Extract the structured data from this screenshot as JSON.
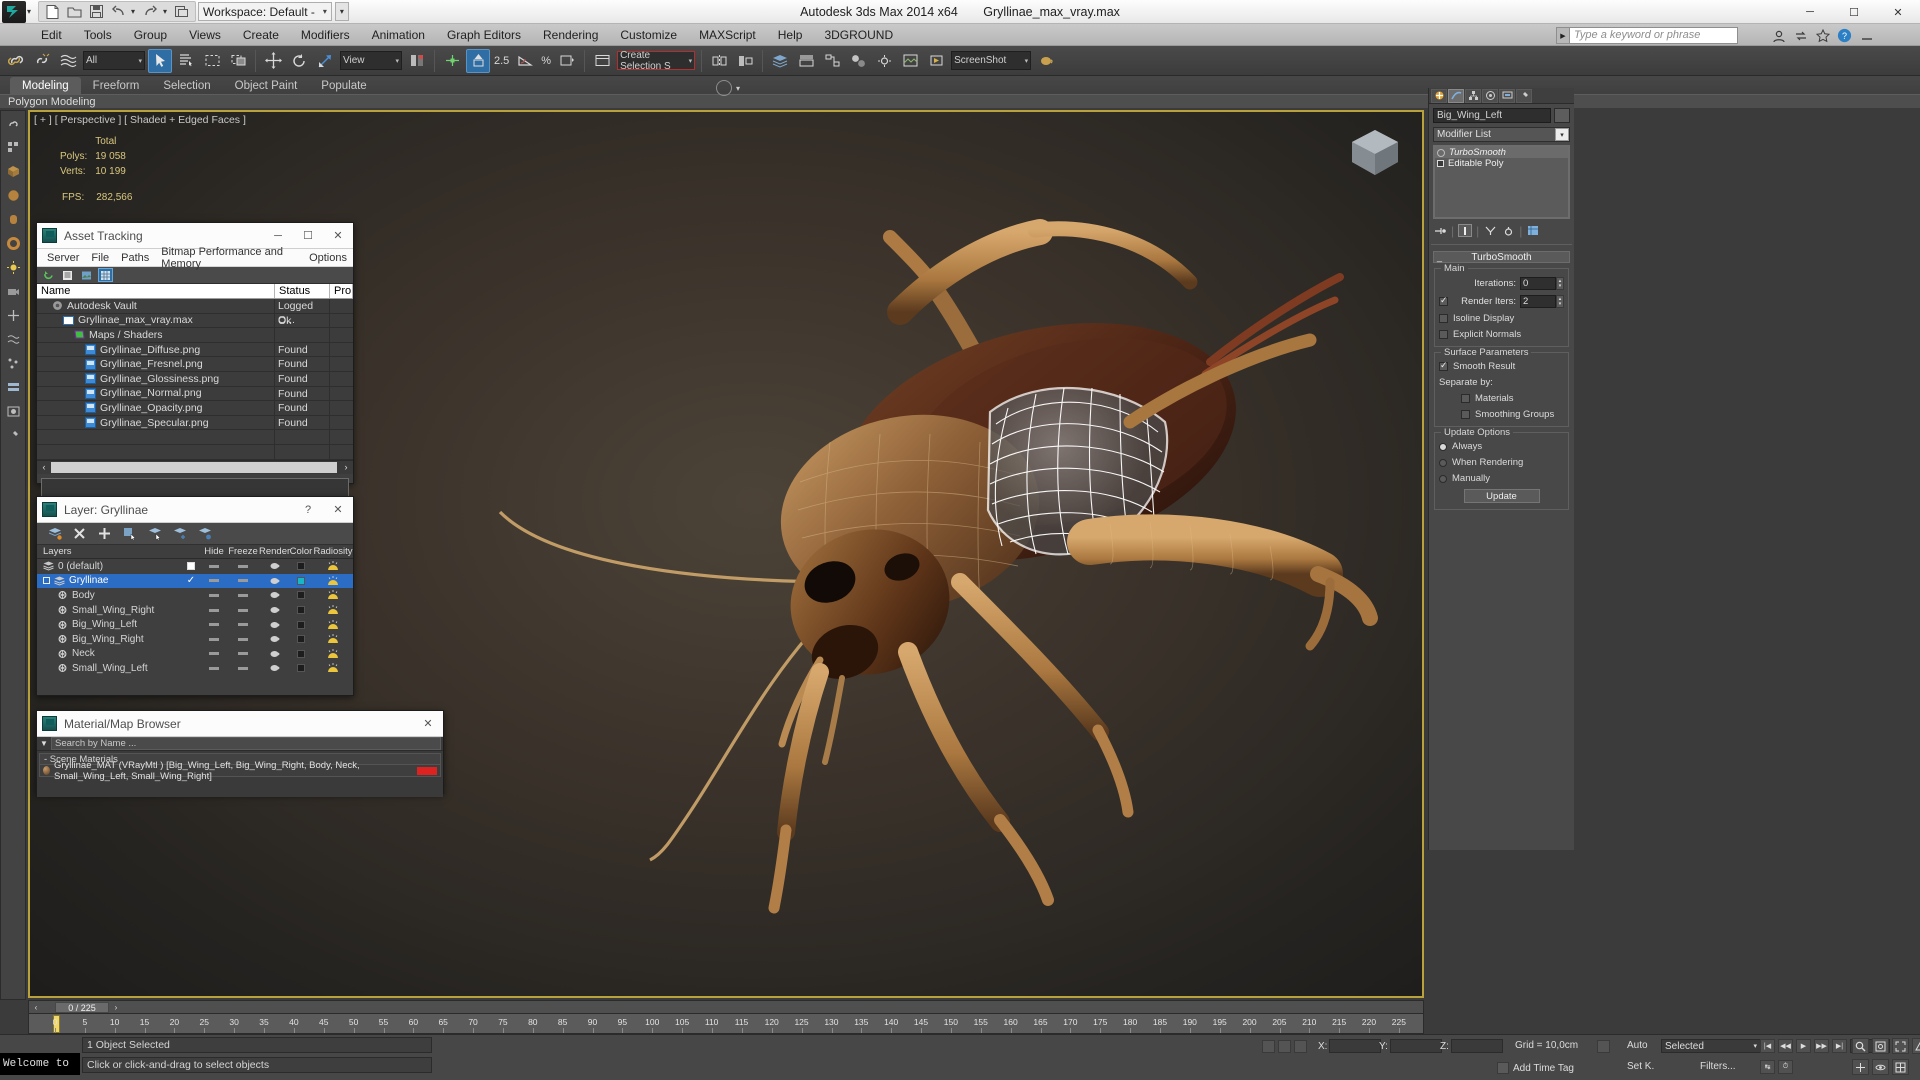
{
  "titlebar": {
    "app_title": "Autodesk 3ds Max  2014 x64",
    "file_name": "Gryllinae_max_vray.max",
    "workspace_label": "Workspace: Default -",
    "quick_access": [
      "new-icon",
      "open-icon",
      "save-icon",
      "undo-icon",
      "redo-icon",
      "set-project-icon"
    ],
    "window_buttons": {
      "minimize": "─",
      "maximize": "☐",
      "close": "✕"
    }
  },
  "menubar": {
    "items": [
      "Edit",
      "Tools",
      "Group",
      "Views",
      "Create",
      "Modifiers",
      "Animation",
      "Graph Editors",
      "Rendering",
      "Customize",
      "MAXScript",
      "Help",
      "3DGROUND"
    ],
    "search_placeholder": "Type a keyword or phrase",
    "right_icons": [
      "signin-icon",
      "exchange-icon",
      "star-icon",
      "help-icon",
      "minimize-icon"
    ]
  },
  "maintoolbar": {
    "selection_filter": "All",
    "reference_coord": "View",
    "named_selection_placeholder": "Create Selection S",
    "angle_snap_value": "2.5",
    "percent_label": "%",
    "render_preset": "ScreenShot"
  },
  "ribbon": {
    "tabs": [
      "Modeling",
      "Freeform",
      "Selection",
      "Object Paint",
      "Populate"
    ],
    "active_tab": "Modeling",
    "panel_label": "Polygon Modeling"
  },
  "viewport": {
    "label": "[ + ] [ Perspective ] [ Shaded + Edged Faces ]",
    "stats": {
      "header": "Total",
      "rows": [
        {
          "key": "Polys:",
          "value": "19 058"
        },
        {
          "key": "Verts:",
          "value": "10 199"
        }
      ],
      "fps_key": "FPS:",
      "fps_value": "282,566"
    }
  },
  "asset_tracking": {
    "title": "Asset Tracking",
    "menu": [
      "Server",
      "File",
      "Paths",
      "Bitmap Performance and Memory",
      "Options"
    ],
    "toolbar_icons": [
      "refresh-icon",
      "list-icon",
      "thumbnail-icon",
      "grid-icon"
    ],
    "columns": [
      "Name",
      "Status",
      "Pro"
    ],
    "rows": [
      {
        "name": "Autodesk Vault",
        "status": "Logged O...",
        "indent": 1,
        "icon": "vault-icon"
      },
      {
        "name": "Gryllinae_max_vray.max",
        "status": "Ok",
        "indent": 2,
        "icon": "maxfile-icon"
      },
      {
        "name": "Maps / Shaders",
        "status": "",
        "indent": 3,
        "icon": "maps-icon"
      },
      {
        "name": "Gryllinae_Diffuse.png",
        "status": "Found",
        "indent": 4,
        "icon": "bitmap-icon"
      },
      {
        "name": "Gryllinae_Fresnel.png",
        "status": "Found",
        "indent": 4,
        "icon": "bitmap-icon"
      },
      {
        "name": "Gryllinae_Glossiness.png",
        "status": "Found",
        "indent": 4,
        "icon": "bitmap-icon"
      },
      {
        "name": "Gryllinae_Normal.png",
        "status": "Found",
        "indent": 4,
        "icon": "bitmap-icon"
      },
      {
        "name": "Gryllinae_Opacity.png",
        "status": "Found",
        "indent": 4,
        "icon": "bitmap-icon"
      },
      {
        "name": "Gryllinae_Specular.png",
        "status": "Found",
        "indent": 4,
        "icon": "bitmap-icon"
      },
      {
        "name": "",
        "status": "",
        "indent": 0,
        "icon": ""
      },
      {
        "name": "",
        "status": "",
        "indent": 0,
        "icon": ""
      }
    ],
    "window_buttons": {
      "minimize": "─",
      "maximize": "☐",
      "close": "✕"
    }
  },
  "layer_dialog": {
    "title": "Layer: Gryllinae",
    "help_button": "?",
    "close_button": "✕",
    "toolbar_icons": [
      "new-layer-icon",
      "delete-layer-icon",
      "add-layer-icon",
      "select-objects-icon",
      "highlight-icon",
      "add-selection-icon",
      "set-current-icon"
    ],
    "columns": [
      "Layers",
      "Hide",
      "Freeze",
      "Render",
      "Color",
      "Radiosity"
    ],
    "rows": [
      {
        "name": "0 (default)",
        "indent": 0,
        "current": false,
        "selected": false,
        "color": "#1d1d1d",
        "checkbox": true
      },
      {
        "name": "Gryllinae",
        "indent": 0,
        "current": true,
        "selected": true,
        "color": "#19b7c6",
        "checkbox": false
      },
      {
        "name": "Body",
        "indent": 1,
        "current": false,
        "selected": false,
        "color": "#1d1d1d",
        "checkbox": false
      },
      {
        "name": "Small_Wing_Right",
        "indent": 1,
        "current": false,
        "selected": false,
        "color": "#1d1d1d",
        "checkbox": false
      },
      {
        "name": "Big_Wing_Left",
        "indent": 1,
        "current": false,
        "selected": false,
        "color": "#1d1d1d",
        "checkbox": false
      },
      {
        "name": "Big_Wing_Right",
        "indent": 1,
        "current": false,
        "selected": false,
        "color": "#1d1d1d",
        "checkbox": false
      },
      {
        "name": "Neck",
        "indent": 1,
        "current": false,
        "selected": false,
        "color": "#1d1d1d",
        "checkbox": false
      },
      {
        "name": "Small_Wing_Left",
        "indent": 1,
        "current": false,
        "selected": false,
        "color": "#1d1d1d",
        "checkbox": false
      }
    ]
  },
  "material_browser": {
    "title": "Material/Map Browser",
    "close_button": "✕",
    "search_placeholder": "Search by Name ...",
    "group_label": "- Scene Materials",
    "items": [
      {
        "label": "Gryllinae_MAT  (VRayMtl )  [Big_Wing_Left, Big_Wing_Right, Body, Neck, Small_Wing_Left, Small_Wing_Right]"
      }
    ]
  },
  "command_panel": {
    "tabs": [
      "create-tab",
      "modify-tab",
      "hierarchy-tab",
      "motion-tab",
      "display-tab",
      "utilities-tab"
    ],
    "active_tab": "modify-tab",
    "object_name": "Big_Wing_Left",
    "modifier_list_label": "Modifier List",
    "stack": [
      {
        "label": "TurboSmooth",
        "active": true
      },
      {
        "label": "Editable Poly",
        "active": false
      }
    ],
    "rollout_title": "TurboSmooth",
    "main_group": {
      "label": "Main",
      "iterations_label": "Iterations:",
      "iterations_value": "0",
      "render_iters_label": "Render Iters:",
      "render_iters_value": "2",
      "render_iters_checked": true,
      "isoline_label": "Isoline Display",
      "isoline_checked": false,
      "explicit_label": "Explicit Normals",
      "explicit_checked": false
    },
    "surface_group": {
      "label": "Surface Parameters",
      "smooth_result_label": "Smooth Result",
      "smooth_result_checked": true,
      "separate_by_label": "Separate by:",
      "materials_label": "Materials",
      "materials_checked": false,
      "smoothing_groups_label": "Smoothing Groups",
      "smoothing_groups_checked": false
    },
    "update_group": {
      "label": "Update Options",
      "options": [
        {
          "label": "Always",
          "selected": true
        },
        {
          "label": "When Rendering",
          "selected": false
        },
        {
          "label": "Manually",
          "selected": false
        }
      ],
      "button_label": "Update"
    }
  },
  "timeline": {
    "frame_display": "0 / 225",
    "prev_arrow": "‹",
    "next_arrow": "›",
    "ticks": [
      "0",
      "5",
      "10",
      "15",
      "20",
      "25",
      "30",
      "35",
      "40",
      "45",
      "50",
      "55",
      "60",
      "65",
      "70",
      "75",
      "80",
      "85",
      "90",
      "95",
      "100",
      "105",
      "110",
      "115",
      "120",
      "125",
      "130",
      "135",
      "140",
      "145",
      "150",
      "155",
      "160",
      "165",
      "170",
      "175",
      "180",
      "185",
      "190",
      "195",
      "200",
      "205",
      "210",
      "215",
      "220",
      "225"
    ]
  },
  "statusbar": {
    "welcome_text": "Welcome to",
    "selection_text": "1 Object Selected",
    "prompt_text": "Click or click-and-drag to select objects",
    "coords": [
      {
        "axis": "X:",
        "value": ""
      },
      {
        "axis": "Y:",
        "value": ""
      },
      {
        "axis": "Z:",
        "value": ""
      }
    ],
    "grid_label": "Grid = 10,0cm",
    "auto_label": "Auto",
    "setkey_label": "Set K.",
    "selected_label": "Selected",
    "key_filters_label": "Filters...",
    "add_time_tag": "Add Time Tag"
  },
  "colors": {
    "accent_gold": "#b9a13c",
    "selection_blue": "#2b6cc4",
    "panel_bg": "#484848",
    "toolbar_bg": "#3c3c3c",
    "status_yellow": "#d8c77e"
  }
}
